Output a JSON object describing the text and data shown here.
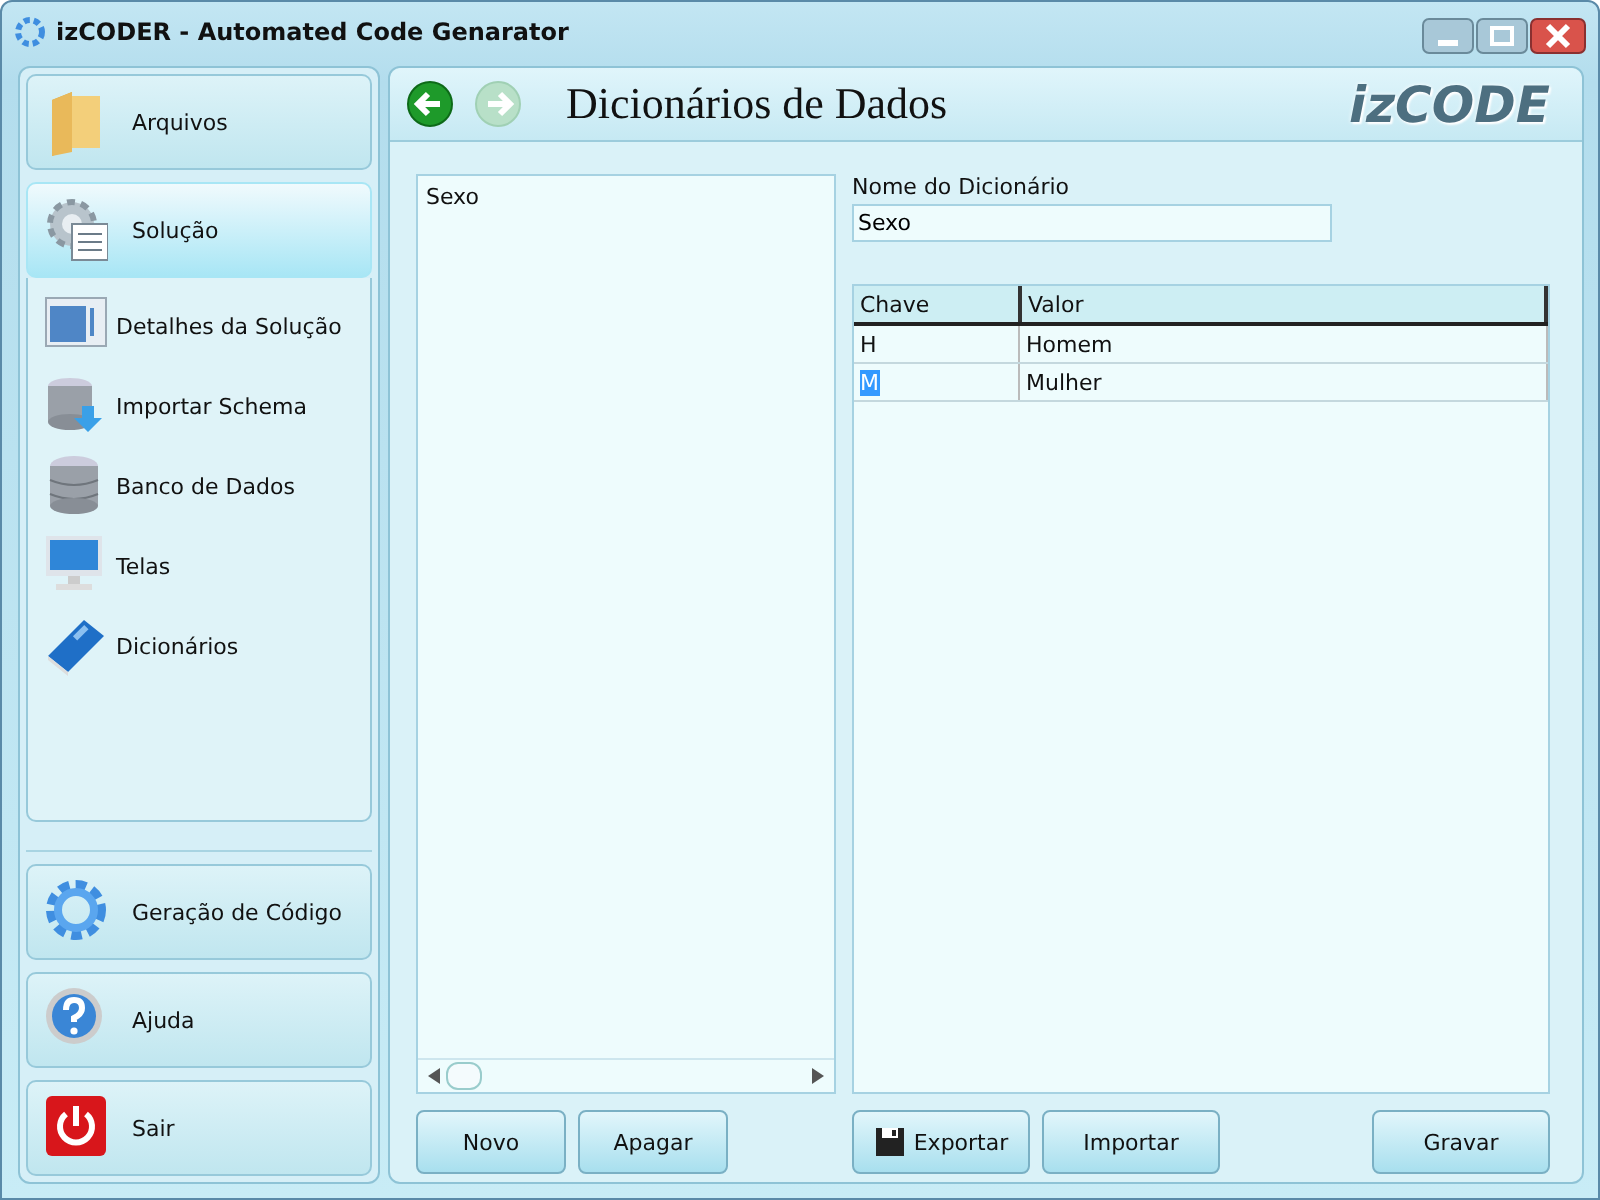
{
  "window": {
    "title": "izCODER - Automated Code Genarator"
  },
  "sidebar": {
    "top": [
      {
        "label": "Arquivos",
        "selected": false
      },
      {
        "label": "Solução",
        "selected": true
      }
    ],
    "items": [
      {
        "label": "Detalhes da Solução"
      },
      {
        "label": "Importar Schema"
      },
      {
        "label": "Banco de Dados"
      },
      {
        "label": "Telas"
      },
      {
        "label": "Dicionários"
      }
    ],
    "bottom": [
      {
        "label": "Geração de Código"
      },
      {
        "label": "Ajuda"
      },
      {
        "label": "Sair"
      }
    ]
  },
  "header": {
    "back_disabled": false,
    "forward_disabled": true,
    "title": "Dicionários de Dados",
    "logo": "izCODE"
  },
  "list": {
    "items": [
      "Sexo"
    ]
  },
  "form": {
    "name_label": "Nome do Dicionário",
    "name_value": "Sexo",
    "columns": [
      "Chave",
      "Valor"
    ],
    "rows": [
      {
        "key": "H",
        "value": "Homem",
        "key_selected": false
      },
      {
        "key": "M",
        "value": "Mulher",
        "key_selected": true
      }
    ]
  },
  "buttons_left": [
    "Novo",
    "Apagar"
  ],
  "buttons_right": [
    {
      "label": "Exportar",
      "kind": "save"
    },
    {
      "label": "Importar",
      "kind": "plain"
    }
  ],
  "save_button": "Gravar"
}
